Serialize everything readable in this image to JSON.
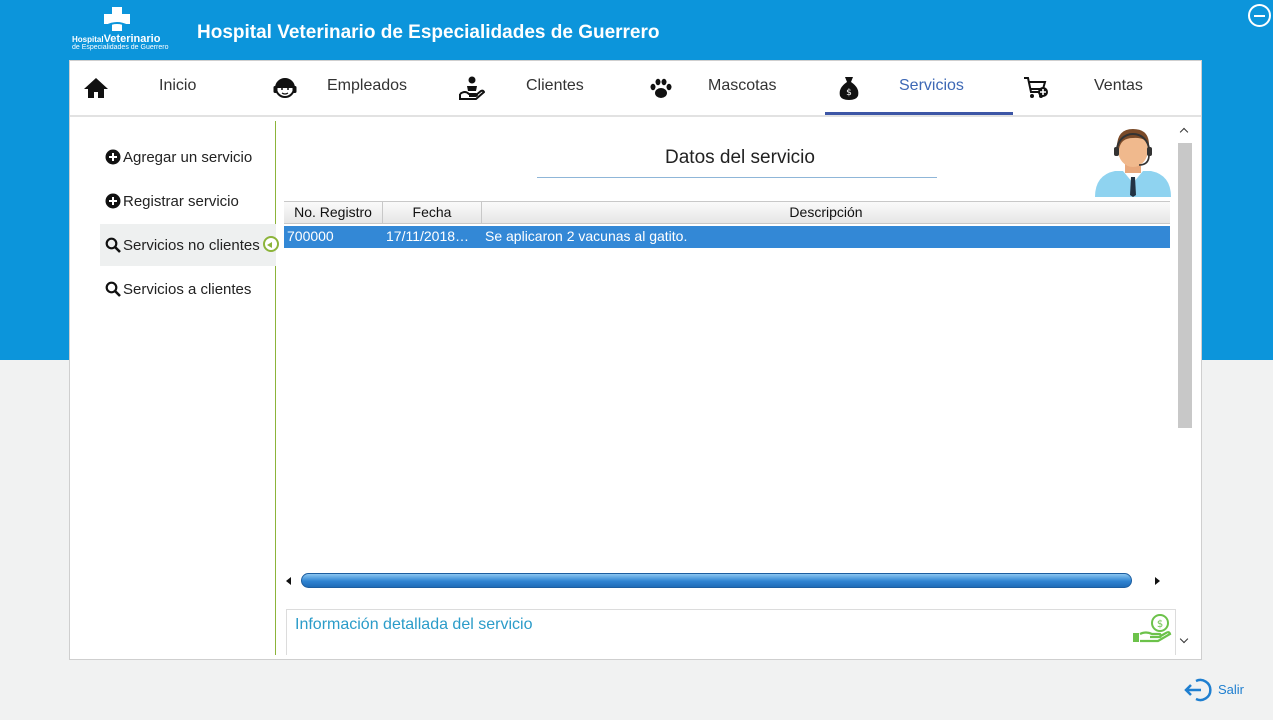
{
  "app": {
    "title": "Hospital Veterinario de Especialidades de Guerrero",
    "logo_line1_a": "Hospital",
    "logo_line1_b": "Veterinario",
    "logo_line2": "de Especialidades de Guerrero"
  },
  "nav": {
    "items": [
      {
        "label": "Inicio",
        "icon": "home-icon"
      },
      {
        "label": "Empleados",
        "icon": "headset-person-icon"
      },
      {
        "label": "Clientes",
        "icon": "helping-hand-icon"
      },
      {
        "label": "Mascotas",
        "icon": "paw-icon"
      },
      {
        "label": "Servicios",
        "icon": "money-bag-icon"
      },
      {
        "label": "Ventas",
        "icon": "cart-add-icon"
      }
    ],
    "active": "Servicios"
  },
  "sidebar": {
    "items": [
      {
        "label": "Agregar un servicio",
        "icon": "plus-circle-icon"
      },
      {
        "label": "Registrar servicio",
        "icon": "plus-circle-icon"
      },
      {
        "label": "Servicios no clientes",
        "icon": "search-icon"
      },
      {
        "label": "Servicios a clientes",
        "icon": "search-icon"
      }
    ],
    "selected": "Servicios no clientes"
  },
  "panel": {
    "title": "Datos del servicio",
    "table": {
      "columns": [
        "No. Registro",
        "Fecha",
        "Descripción"
      ],
      "rows": [
        [
          "700000",
          "17/11/2018…",
          "Se aplicaron 2 vacunas al gatito."
        ]
      ]
    },
    "info_title": "Información detallada del servicio"
  },
  "footer": {
    "exit_label": "Salir"
  },
  "colors": {
    "brand_blue": "#0c95db",
    "selection_blue": "#3388d6",
    "sidebar_accent": "#8cb43a",
    "info_text": "#2b9cc9"
  }
}
